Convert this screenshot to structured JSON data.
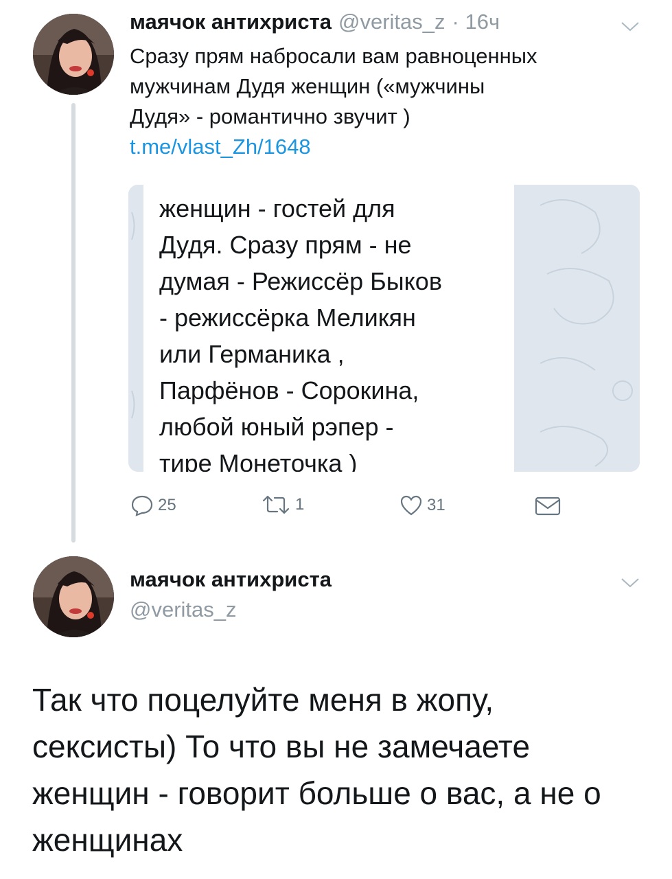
{
  "tweet1": {
    "name": "маячок антихриста",
    "handle": "@veritas_z",
    "time": "· 16ч",
    "text_lines": [
      "Сразу прям набросали вам равноценных",
      "мужчинам Дудя женщин («мужчины",
      "Дудя» - романтично звучит )"
    ],
    "link": "t.me/vlast_Zh/1648",
    "card_lines": [
      "женщин - гостей для",
      "Дудя. Сразу прям - не",
      "думая - Режиссёр Быков",
      "- режиссёрка Меликян",
      "или Германика ,",
      "Парфёнов - Сорокина,",
      "любой юный рэпер -",
      "тире Монеточка )"
    ],
    "actions": {
      "reply_count": "25",
      "retweet_count": "1",
      "like_count": "31"
    }
  },
  "tweet2": {
    "name": "маячок антихриста",
    "handle": "@veritas_z",
    "text_lines": [
      "Так что поцелуйте меня в жопу,",
      "сексисты) То что вы не замечаете",
      "женщин - говорит больше о вас, а не о",
      "женщинах"
    ]
  },
  "colors": {
    "link": "#1b95e0",
    "muted": "#8f9aa3",
    "thread_line": "#d6dbe0"
  }
}
